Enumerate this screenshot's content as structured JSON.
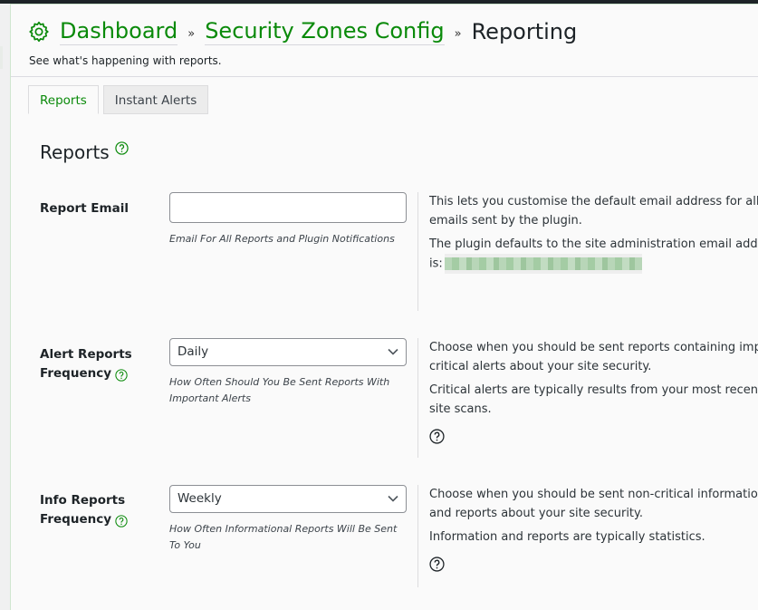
{
  "header": {
    "breadcrumb": [
      {
        "label": "Dashboard",
        "link": true
      },
      {
        "label": "Security Zones Config",
        "link": true
      },
      {
        "label": "Reporting",
        "link": false
      }
    ],
    "separator": "»",
    "subtitle": "See what's happening with reports.",
    "icon": "gear-icon"
  },
  "tabs": [
    {
      "label": "Reports",
      "active": true
    },
    {
      "label": "Instant Alerts",
      "active": false
    }
  ],
  "section": {
    "title": "Reports"
  },
  "fields": {
    "report_email": {
      "label": "Report Email",
      "value": "",
      "placeholder": "",
      "hint": "Email For All Reports and Plugin Notifications",
      "desc1": "This lets you customise the default email address for all emails sent by the plugin.",
      "desc2_prefix": "The plugin defaults to the site administration email address, which is:",
      "desc2_line2": "is:"
    },
    "alert_frequency": {
      "label_line1": "Alert Reports",
      "label_line2": "Frequency",
      "selected": "Daily",
      "hint": "How Often Should You Be Sent Reports With Important Alerts",
      "desc1": "Choose when you should be sent reports containing important and critical alerts about your site security.",
      "desc2": "Critical alerts are typically results from your most recent site scans."
    },
    "info_frequency": {
      "label_line1": "Info Reports",
      "label_line2": "Frequency",
      "selected": "Weekly",
      "hint": "How Often Informational Reports Will Be Sent To You",
      "desc1": "Choose when you should be sent non-critical information and reports about your site security.",
      "desc2": "Information and reports are typically statistics."
    }
  },
  "colors": {
    "accent": "#0a8a0a",
    "text": "#1d2327",
    "panel_bg": "#fafafa"
  }
}
